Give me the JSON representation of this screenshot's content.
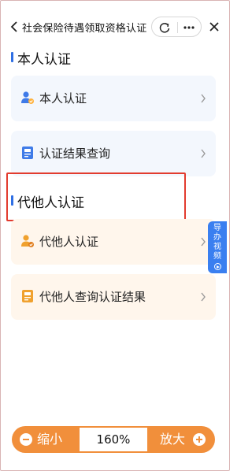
{
  "header": {
    "title": "社会保险待遇领取资格认证",
    "icons": [
      "back-arrow-icon",
      "refresh-icon",
      "more-icon",
      "close-icon"
    ]
  },
  "self_section": {
    "title": "本人认证",
    "items": [
      {
        "label": "本人认证",
        "icon": "person-verify-icon"
      },
      {
        "label": "认证结果查询",
        "icon": "document-icon"
      }
    ]
  },
  "proxy_section": {
    "title": "代他人认证",
    "items": [
      {
        "label": "代他人认证",
        "icon": "person-verify-icon"
      },
      {
        "label": "代他人查询认证结果",
        "icon": "document-icon"
      }
    ]
  },
  "float_tab": {
    "label": "导办视频"
  },
  "zoom": {
    "minus_label": "缩小",
    "value": "160%",
    "plus_label": "放大"
  },
  "colors": {
    "accent_blue": "#2f6fe4",
    "orange": "#f18f3b",
    "highlight_red": "#e23b2e"
  }
}
